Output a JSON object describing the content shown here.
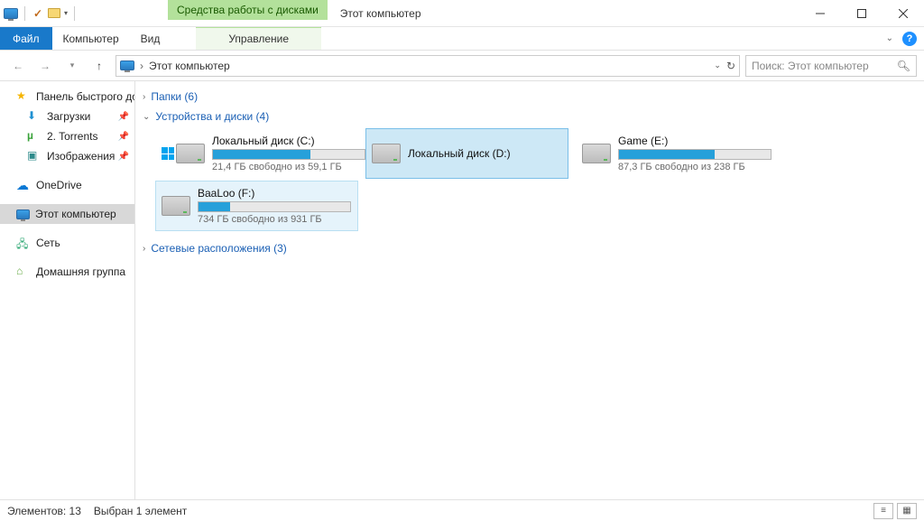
{
  "window": {
    "title": "Этот компьютер",
    "contextual_tab_group": "Средства работы с дисками"
  },
  "ribbon": {
    "file": "Файл",
    "tabs": [
      "Компьютер",
      "Вид"
    ],
    "contextual_tab": "Управление"
  },
  "nav": {
    "breadcrumb_sep": "›",
    "location": "Этот компьютер",
    "search_placeholder": "Поиск: Этот компьютер"
  },
  "sidebar": {
    "quick_access": "Панель быстрого доступа",
    "items": [
      {
        "label": "Загрузки",
        "pinned": true,
        "icon": "downloads"
      },
      {
        "label": "2. Torrents",
        "pinned": true,
        "icon": "utorrent"
      },
      {
        "label": "Изображения",
        "pinned": true,
        "icon": "images"
      }
    ],
    "onedrive": "OneDrive",
    "this_pc": "Этот компьютер",
    "network": "Сеть",
    "homegroup": "Домашняя группа"
  },
  "content": {
    "folders_header": "Папки (6)",
    "drives_header": "Устройства и диски (4)",
    "network_header": "Сетевые расположения (3)",
    "drives": [
      {
        "name": "Локальный диск (C:)",
        "free_text": "21,4 ГБ свободно из 59,1 ГБ",
        "fill_pct": 64,
        "os": true,
        "state": ""
      },
      {
        "name": "Локальный диск (D:)",
        "free_text": "",
        "fill_pct": 0,
        "os": false,
        "state": "selected"
      },
      {
        "name": "Game (E:)",
        "free_text": "87,3 ГБ свободно из 238 ГБ",
        "fill_pct": 63,
        "os": false,
        "state": ""
      },
      {
        "name": "BaaLoo (F:)",
        "free_text": "734 ГБ свободно из 931 ГБ",
        "fill_pct": 21,
        "os": false,
        "state": "hover"
      }
    ]
  },
  "statusbar": {
    "items_label": "Элементов:",
    "items_count": "13",
    "selected_label": "Выбран 1 элемент"
  }
}
